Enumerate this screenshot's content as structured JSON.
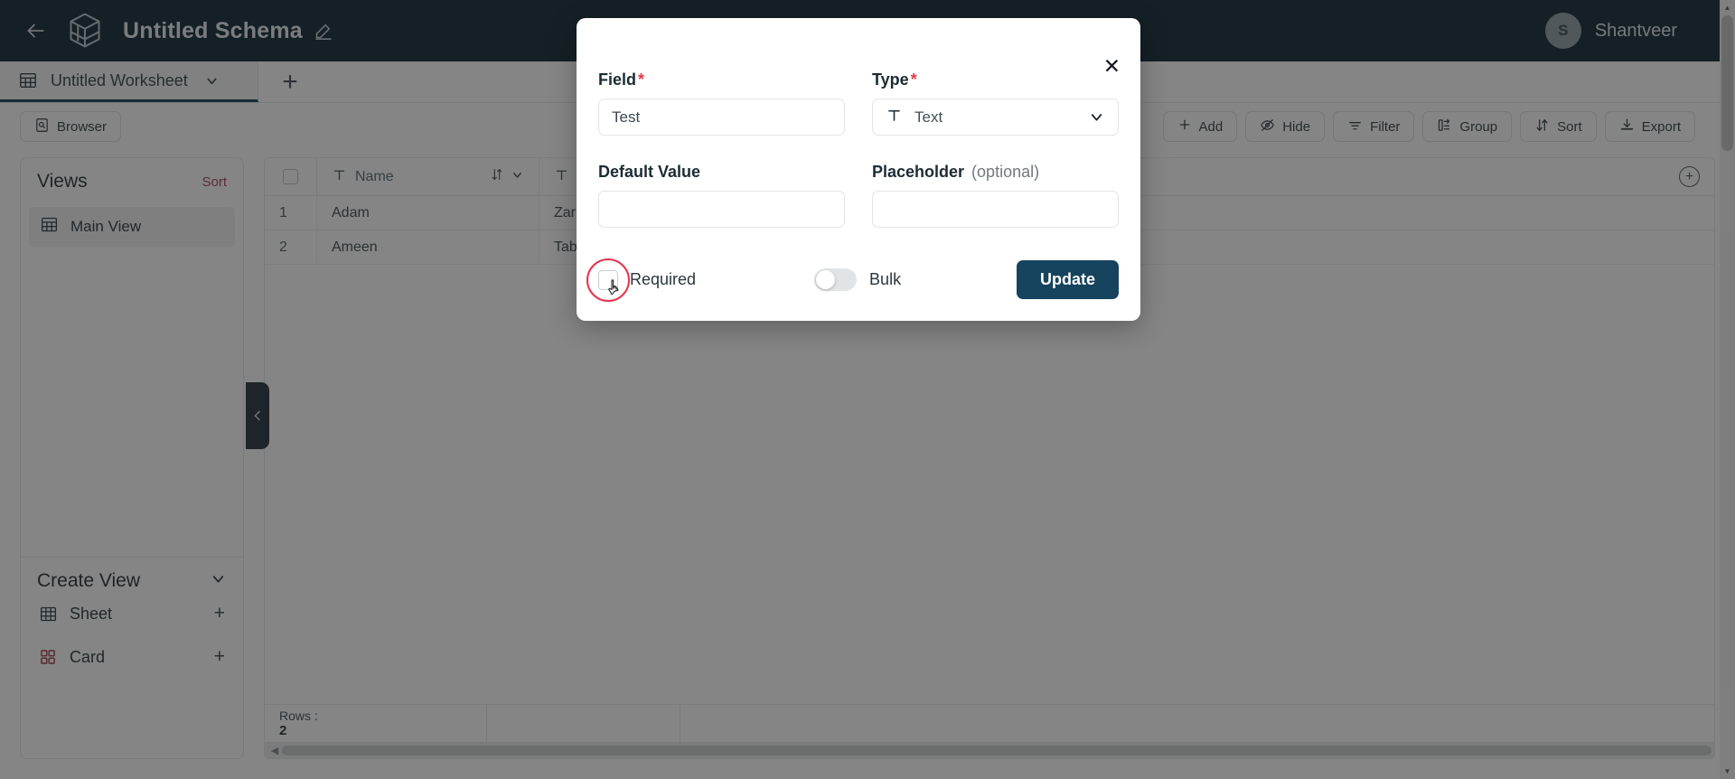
{
  "topbar": {
    "back_icon": "arrow-left-icon",
    "logo_icon": "cube-logo-icon",
    "title": "Untitled Schema",
    "edit_icon": "pencil-icon",
    "user": {
      "initial": "S",
      "name": "Shantveer"
    }
  },
  "tabstrip": {
    "worksheet_icon": "table-icon",
    "worksheet_label": "Untitled Worksheet",
    "worksheet_chevron": "chevron-down-icon",
    "new_tab_label": "+"
  },
  "toolbar": {
    "browser_label": "Browser",
    "browser_icon": "browser-icon",
    "actions": [
      {
        "label": "Add",
        "icon": "plus-icon"
      },
      {
        "label": "Hide",
        "icon": "eye-off-icon"
      },
      {
        "label": "Filter",
        "icon": "filter-icon"
      },
      {
        "label": "Group",
        "icon": "group-icon"
      },
      {
        "label": "Sort",
        "icon": "sort-icon"
      },
      {
        "label": "Export",
        "icon": "download-icon"
      }
    ]
  },
  "sidebar": {
    "views_title": "Views",
    "views_sort_label": "Sort",
    "views": [
      {
        "label": "Main View",
        "icon": "table-icon"
      }
    ],
    "create_view": {
      "title": "Create View",
      "chevron": "chevron-down-icon",
      "options": [
        {
          "label": "Sheet",
          "icon": "sheet-icon",
          "action": "+"
        },
        {
          "label": "Card",
          "icon": "card-icon",
          "action": "+"
        }
      ]
    },
    "collapse_icon": "chevron-left-icon"
  },
  "grid": {
    "columns": [
      {
        "label": "Name",
        "icon": "text-type-icon"
      },
      {
        "label": "",
        "icon": "text-type-icon"
      }
    ],
    "sort_icon": "sort-arrows-icon",
    "column_menu_icon": "chevron-down-icon",
    "add_column_icon": "plus-circle-icon",
    "rows": [
      {
        "index": "1",
        "name": "Adam",
        "col2": "Zar"
      },
      {
        "index": "2",
        "name": "Ameen",
        "col2": "Tab"
      }
    ],
    "footer": {
      "rows_label": "Rows :",
      "rows_value": "2"
    }
  },
  "modal": {
    "close_icon": "close-icon",
    "field": {
      "label": "Field",
      "required_mark": "*",
      "value": "Test"
    },
    "type": {
      "label": "Type",
      "required_mark": "*",
      "icon": "text-type-icon",
      "value": "Text",
      "chevron": "chevron-down-icon"
    },
    "default_value": {
      "label": "Default Value",
      "value": ""
    },
    "placeholder_field": {
      "label": "Placeholder",
      "optional_suffix": "(optional)",
      "value": ""
    },
    "required_toggle": {
      "label": "Required",
      "checked": false
    },
    "bulk_toggle": {
      "label": "Bulk",
      "checked": false
    },
    "submit_label": "Update"
  },
  "colors": {
    "topbar_bg": "#051f2c",
    "accent_dark": "#16435d",
    "required_red": "#e03b4a",
    "cursor_highlight": "#e8334a",
    "sort_link": "#a33b52"
  }
}
